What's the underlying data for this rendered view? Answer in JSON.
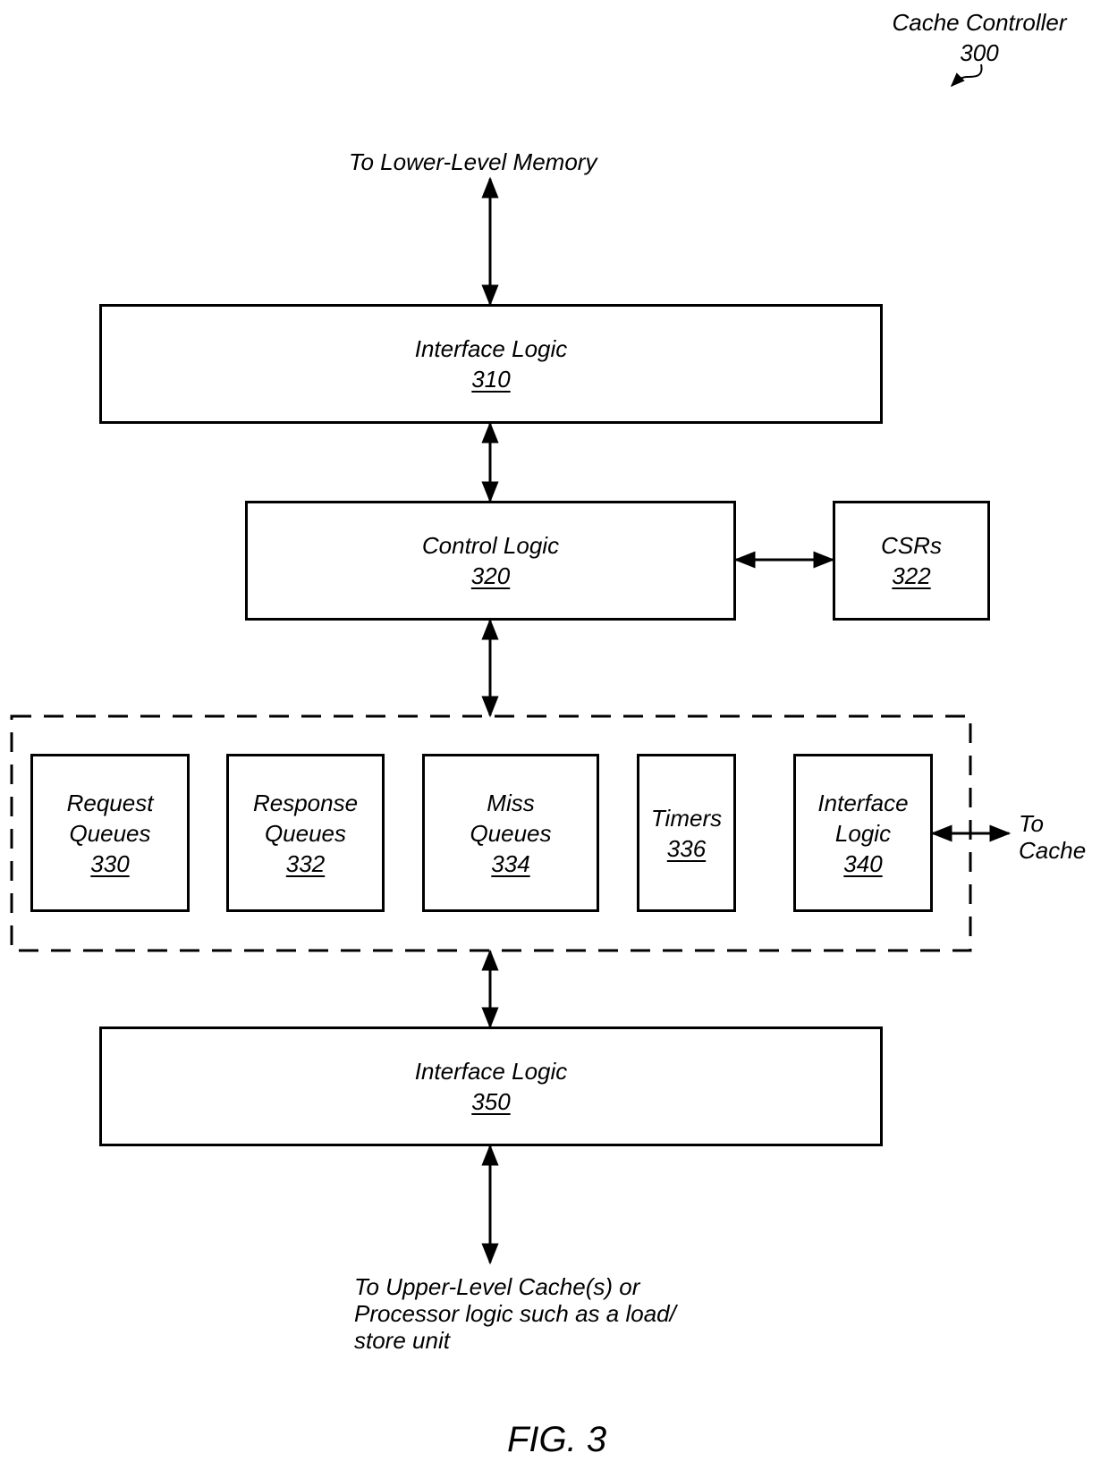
{
  "title": {
    "name": "Cache Controller",
    "ref": "300"
  },
  "labels": {
    "top": "To Lower-Level Memory",
    "bottom_line1": "To Upper-Level Cache(s) or",
    "bottom_line2": "Processor logic such as a load/",
    "bottom_line3": "store unit",
    "to_cache_line1": "To",
    "to_cache_line2": "Cache"
  },
  "blocks": {
    "interface_top": {
      "name": "Interface Logic",
      "ref": "310"
    },
    "control": {
      "name": "Control Logic",
      "ref": "320"
    },
    "csrs": {
      "name": "CSRs",
      "ref": "322"
    },
    "request_queues": {
      "name1": "Request",
      "name2": "Queues",
      "ref": "330"
    },
    "response_queues": {
      "name1": "Response",
      "name2": "Queues",
      "ref": "332"
    },
    "miss_queues": {
      "name1": "Miss",
      "name2": "Queues",
      "ref": "334"
    },
    "timers": {
      "name": "Timers",
      "ref": "336"
    },
    "interface_340": {
      "name1": "Interface",
      "name2": "Logic",
      "ref": "340"
    },
    "interface_bottom": {
      "name": "Interface Logic",
      "ref": "350"
    }
  },
  "figure": "FIG. 3"
}
